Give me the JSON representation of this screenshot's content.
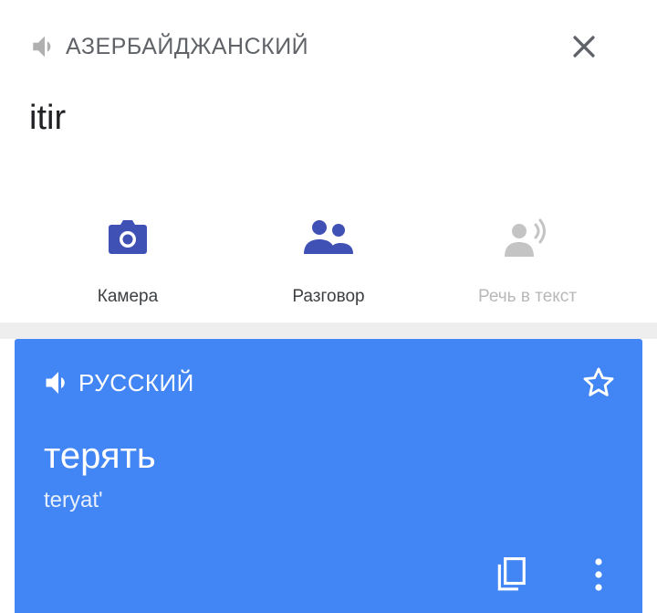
{
  "source": {
    "language": "АЗЕРБАЙДЖАНСКИЙ",
    "text": "itir"
  },
  "actions": [
    {
      "label": "Камера",
      "icon": "camera-icon",
      "enabled": true
    },
    {
      "label": "Разговор",
      "icon": "people-icon",
      "enabled": true
    },
    {
      "label": "Речь в текст",
      "icon": "speech-icon",
      "enabled": false
    }
  ],
  "target": {
    "language": "РУССКИЙ",
    "text": "терять",
    "transliteration": "teryatʹ"
  },
  "colors": {
    "card": "#4285f4",
    "icon_accent": "#3f51b5",
    "disabled": "#b8b8b8"
  }
}
